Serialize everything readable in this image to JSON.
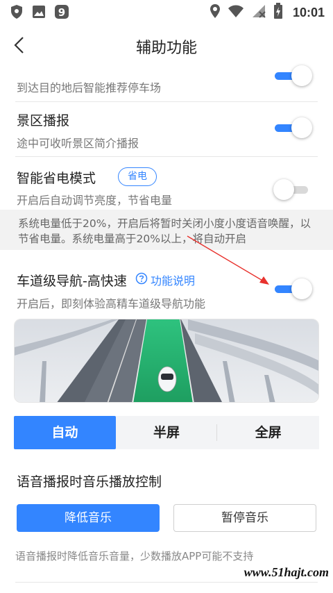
{
  "status_bar": {
    "time": "10:01",
    "left_icons": [
      "shield-icon",
      "image-icon",
      "app-9-icon"
    ],
    "right_icons": [
      "location-icon",
      "wifi-icon",
      "no-signal-icon",
      "battery-charging-icon"
    ]
  },
  "nav": {
    "title": "辅助功能",
    "back_icon": "chevron-left-icon"
  },
  "settings": {
    "parking": {
      "subtitle": "到达目的地后智能推荐停车场",
      "enabled": true
    },
    "scenic": {
      "title": "景区播报",
      "subtitle": "途中可收听景区简介播报",
      "enabled": true
    },
    "power_save": {
      "title": "智能省电模式",
      "badge": "省电",
      "subtitle": "开启后自动调节亮度，节省电量",
      "enabled": false
    },
    "power_notice": "系统电量低于20%，开启后将暂时关闭小度小度语音唤醒，以节省电量。系统电量高于20%以上，将自动开启",
    "lane_nav": {
      "title": "车道级导航-高快速",
      "help_label": "功能说明",
      "subtitle": "开启后，即刻体验高精车道级导航功能",
      "enabled": true
    }
  },
  "display_mode": {
    "options": [
      "自动",
      "半屏",
      "全屏"
    ],
    "selected": "自动"
  },
  "music": {
    "title": "语音播报时音乐播放控制",
    "lower_label": "降低音乐",
    "pause_label": "暂停音乐",
    "note": "语音播报时降低音乐音量，少数播放APP可能不支持"
  },
  "watermark": "www.51hajt.com",
  "colors": {
    "accent": "#3385ff",
    "annotation_arrow": "#e8322d"
  }
}
